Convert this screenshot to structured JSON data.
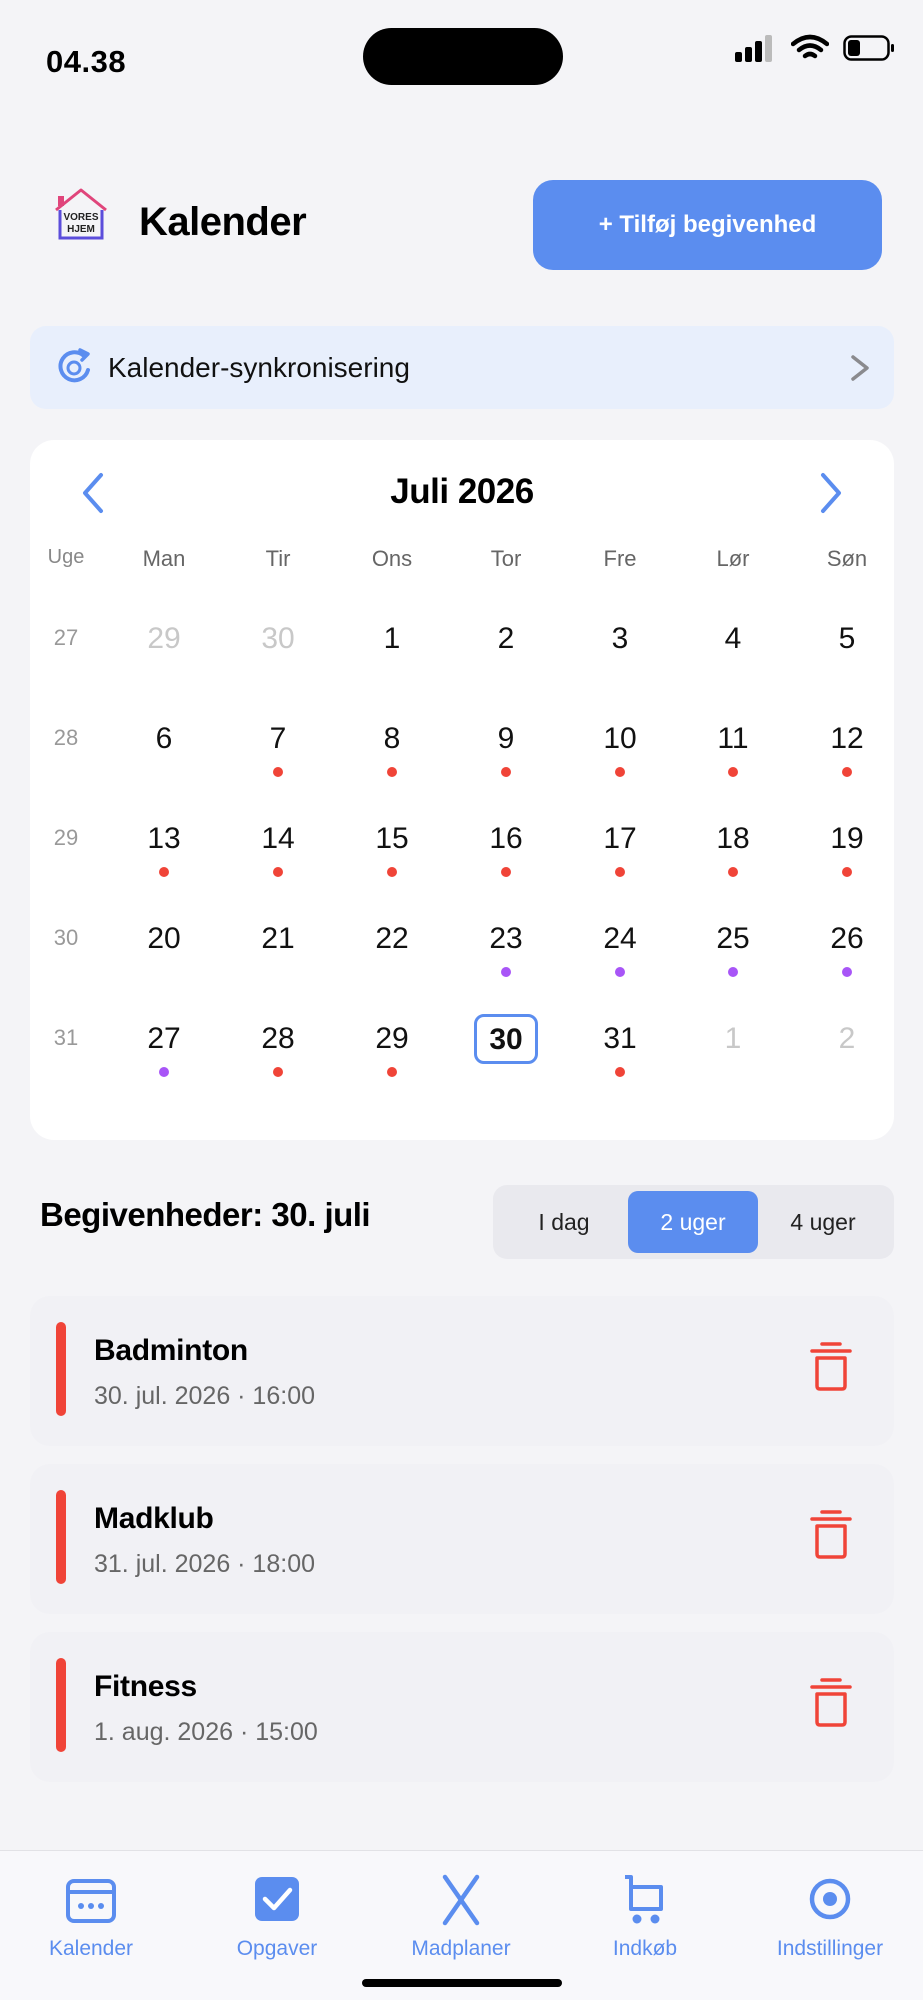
{
  "status_bar": {
    "time": "04.38"
  },
  "header": {
    "logo_text": [
      "VORES",
      "HJEM"
    ],
    "title": "Kalender",
    "add_button_label": "+ Tilføj begivenhed"
  },
  "sync": {
    "label": "Kalender-synkronisering",
    "chevron": ">"
  },
  "calendar": {
    "month_label": "Juli 2026",
    "week_header": "Uge",
    "weekdays": [
      "Man",
      "Tir",
      "Ons",
      "Tor",
      "Fre",
      "Lør",
      "Søn"
    ],
    "today": "30",
    "dot_colors": {
      "red": "#f04438",
      "purple": "#a855f7"
    },
    "weeks": [
      {
        "week": "27",
        "days": [
          {
            "d": "29",
            "muted": true,
            "dot": null
          },
          {
            "d": "30",
            "muted": true,
            "dot": null
          },
          {
            "d": "1",
            "dot": null
          },
          {
            "d": "2",
            "dot": null
          },
          {
            "d": "3",
            "dot": null
          },
          {
            "d": "4",
            "dot": null
          },
          {
            "d": "5",
            "dot": null
          }
        ]
      },
      {
        "week": "28",
        "days": [
          {
            "d": "6",
            "dot": null
          },
          {
            "d": "7",
            "dot": "red"
          },
          {
            "d": "8",
            "dot": "red"
          },
          {
            "d": "9",
            "dot": "red"
          },
          {
            "d": "10",
            "dot": "red"
          },
          {
            "d": "11",
            "dot": "red"
          },
          {
            "d": "12",
            "dot": "red"
          }
        ]
      },
      {
        "week": "29",
        "days": [
          {
            "d": "13",
            "dot": "red"
          },
          {
            "d": "14",
            "dot": "red"
          },
          {
            "d": "15",
            "dot": "red"
          },
          {
            "d": "16",
            "dot": "red"
          },
          {
            "d": "17",
            "dot": "red"
          },
          {
            "d": "18",
            "dot": "red"
          },
          {
            "d": "19",
            "dot": "red"
          }
        ]
      },
      {
        "week": "30",
        "days": [
          {
            "d": "20",
            "dot": null
          },
          {
            "d": "21",
            "dot": null
          },
          {
            "d": "22",
            "dot": null
          },
          {
            "d": "23",
            "dot": "purple"
          },
          {
            "d": "24",
            "dot": "purple"
          },
          {
            "d": "25",
            "dot": "purple"
          },
          {
            "d": "26",
            "dot": "purple"
          }
        ]
      },
      {
        "week": "31",
        "days": [
          {
            "d": "27",
            "dot": "purple"
          },
          {
            "d": "28",
            "dot": "red"
          },
          {
            "d": "29",
            "dot": "red"
          },
          {
            "d": "30",
            "dot": null,
            "today": true
          },
          {
            "d": "31",
            "dot": "red"
          },
          {
            "d": "1",
            "muted": true,
            "dot": null
          },
          {
            "d": "2",
            "muted": true,
            "dot": null
          }
        ]
      }
    ]
  },
  "events_section": {
    "title": "Begivenheder: 30. juli",
    "range_options": [
      "I dag",
      "2 uger",
      "4 uger"
    ],
    "selected_range": "2 uger"
  },
  "events": [
    {
      "title": "Badminton",
      "datetime": "30. jul. 2026 · 16:00",
      "color": "#f04438"
    },
    {
      "title": "Madklub",
      "datetime": "31. jul. 2026 · 18:00",
      "color": "#f04438"
    },
    {
      "title": "Fitness",
      "datetime": "1. aug. 2026 · 15:00",
      "color": "#f04438"
    }
  ],
  "tabbar": {
    "accent": "#5b8def",
    "tabs": [
      {
        "label": "Kalender",
        "icon": "calendar-icon"
      },
      {
        "label": "Opgaver",
        "icon": "checkbox-icon"
      },
      {
        "label": "Madplaner",
        "icon": "fork-knife-icon"
      },
      {
        "label": "Indkøb",
        "icon": "cart-icon"
      },
      {
        "label": "Indstillinger",
        "icon": "settings-icon"
      }
    ]
  }
}
